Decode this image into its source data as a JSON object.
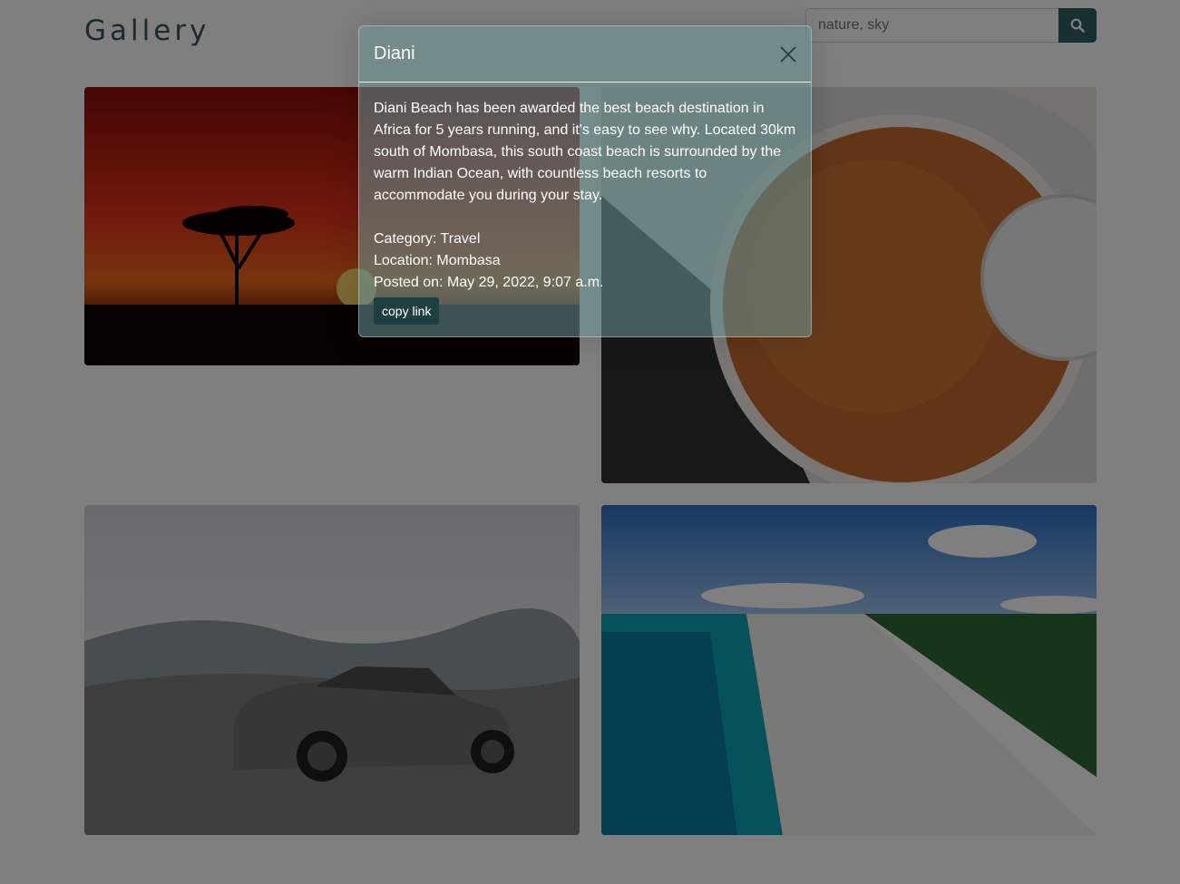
{
  "navbar": {
    "brand": "Gallery",
    "search_placeholder": "nature, sky",
    "search_icon": "search-icon"
  },
  "gallery": {
    "images": [
      {
        "subject": "acacia tree silhouette at sunset"
      },
      {
        "subject": "bowl of pilau rice"
      },
      {
        "subject": "grey sedan car on mountain overlook"
      },
      {
        "subject": "aerial view of beach with turquoise water"
      }
    ]
  },
  "modal": {
    "title": "Diani",
    "close_icon": "close-icon",
    "description": "Diani Beach has been awarded the best beach destination in Africa for 5 years running, and it's easy to see why. Located 30km south of Mombasa, this south coast beach is surrounded by the warm Indian Ocean, with countless beach resorts to accommodate you during your stay.",
    "category": "Category: Travel",
    "location": "Location: Mombasa",
    "posted": "Posted on: May 29, 2022, 9:07 a.m.",
    "copy_label": "copy link"
  },
  "colors": {
    "brand": "#3b5459",
    "search_button": "#2f5e62",
    "copy_button": "#1d3f3f"
  }
}
